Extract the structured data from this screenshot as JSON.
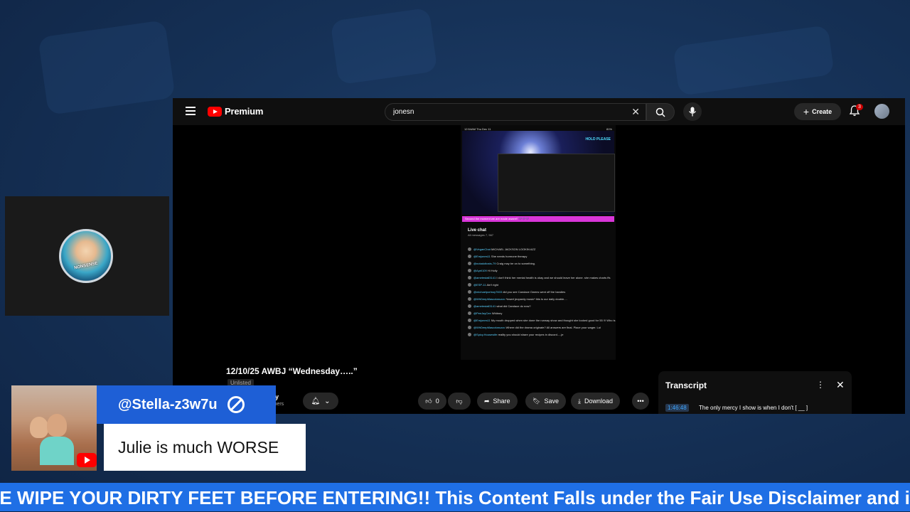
{
  "header": {
    "logo_text": "Premium",
    "search_value": "jonesn",
    "create_label": "Create",
    "notification_count": "3"
  },
  "player": {
    "phone_time": "12:54AM  Thu Dec 11",
    "phone_battery": "81%",
    "hold_text": "HOLD PLEASE",
    "pink_banner": "Second the moment we are made aware!! 💜💜💜",
    "live_chat_title": "Live chat",
    "live_chat_sub": "All messages  7, 567",
    "chat_rows": [
      {
        "name": "@VeganChat",
        "text": "MICHAEL JACKSON LOOKIN AZZ"
      },
      {
        "name": "@Emjones11",
        "text": "She needs hormone therapy"
      },
      {
        "name": "@notadoltosts-79",
        "text": "Craig may be on to something."
      },
      {
        "name": "@April109",
        "text": "Hi Holly"
      },
      {
        "name": "@ametestall3141",
        "text": "I don't think her mental health is okay and we should leave her alone. she makes charts ffs"
      },
      {
        "name": "@ESP-11",
        "text": "Ain't right"
      },
      {
        "name": "@michaelportnoy7603",
        "text": "did you see Candace Owens went off the handles"
      },
      {
        "name": "@WhDeepMascotaruzzo",
        "text": "*insert jeopardy music* this is our daily double...."
      },
      {
        "name": "@ametestall3141",
        "text": "what did Candace do now?"
      },
      {
        "name": "@PeeJayCee",
        "text": "Whitney"
      },
      {
        "name": "@Emjones11",
        "text": "My mouth dropped when she done the runway show and thought she looked good for 55 !!! Who is she comparing herself to??"
      },
      {
        "name": "@WhDeepMascotaruzzo",
        "text": "Where did the drama originate? All answers are final. Place your wager. Lol"
      },
      {
        "name": "@Spicy.Housewife",
        "text": "reality you should share your recipes in discord.....je"
      }
    ]
  },
  "video": {
    "title": "12/10/25 AWBJ “Wednesday…..”",
    "unlisted": "Unlisted",
    "channel_partial": "ty",
    "subs_partial": "ibers",
    "like_count": "0",
    "share_label": "Share",
    "save_label": "Save",
    "download_label": "Download"
  },
  "transcript": {
    "title": "Transcript",
    "time": "1:46:48",
    "text": "The only mercy I show is when I don't [ __ ]"
  },
  "cam": {
    "avatar_text": "NONSENSE"
  },
  "chat_overlay": {
    "username": "@Stella-z3w7u",
    "message": "Julie is much WORSE"
  },
  "ticker": {
    "text": "SE WIPE YOUR DIRTY FEET BEFORE ENTERING!! This Content Falls under the Fair Use Disclaimer and is for"
  },
  "colors": {
    "ticker_bg": "#1f6fe5",
    "overlay_name_bg": "#1e5fd6",
    "yt_red": "#ff0000",
    "background": "#163258"
  }
}
